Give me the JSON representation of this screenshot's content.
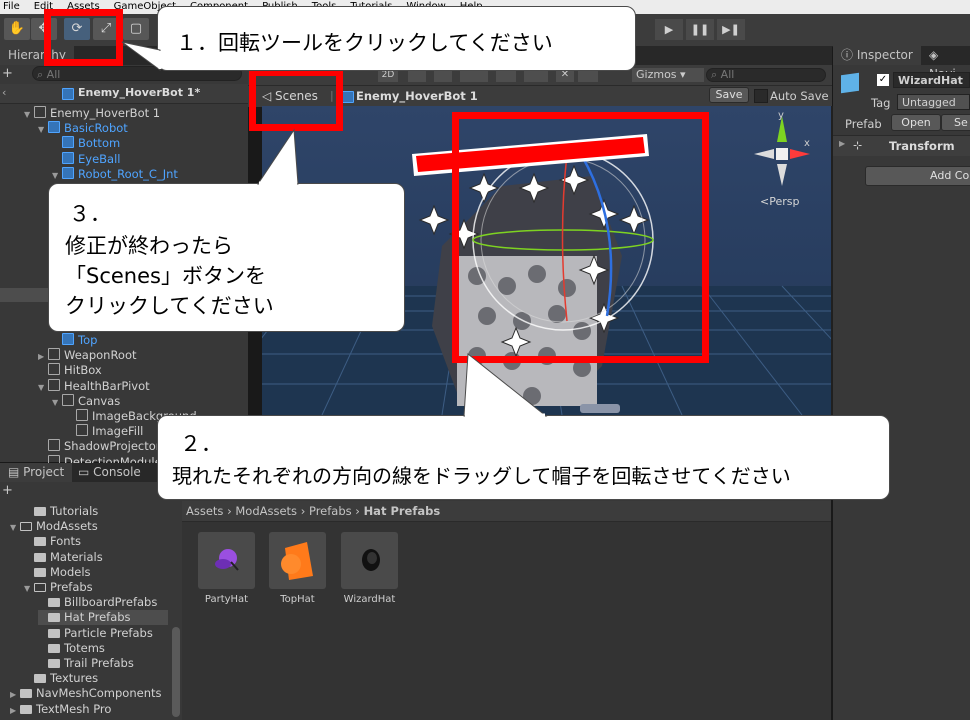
{
  "menu": [
    "File",
    "Edit",
    "Assets",
    "GameObject",
    "Component",
    "Publish",
    "Tools",
    "Tutorials",
    "Window",
    "Help"
  ],
  "toolbar": {
    "hand_icon": "hand-icon",
    "move_icon": "move-icon",
    "rotate_icon": "rotate-icon",
    "scale_icon": "scale-icon",
    "rect_icon": "rect-icon",
    "play": "▶",
    "pause": "❚❚",
    "step": "▶❚"
  },
  "hierarchy": {
    "tab_label": "Hierarchy",
    "search_placeholder": "All",
    "add": "+",
    "scene_title": "Enemy_HoverBot 1*",
    "rows": [
      {
        "label": "Enemy_HoverBot 1",
        "indent": 0,
        "tri": "▼",
        "blue": false
      },
      {
        "label": "BasicRobot",
        "indent": 1,
        "tri": "▼",
        "blue": true
      },
      {
        "label": "Bottom",
        "indent": 2,
        "tri": "",
        "blue": true
      },
      {
        "label": "EyeBall",
        "indent": 2,
        "tri": "",
        "blue": true
      },
      {
        "label": "Robot_Root_C_Jnt",
        "indent": 2,
        "tri": "▼",
        "blue": true
      }
    ],
    "rows_lower": [
      {
        "label": "Top",
        "indent": 2,
        "tri": "",
        "blue": true
      },
      {
        "label": "WeaponRoot",
        "indent": 1,
        "tri": "▶",
        "blue": false
      },
      {
        "label": "HitBox",
        "indent": 1,
        "tri": "",
        "blue": false
      },
      {
        "label": "HealthBarPivot",
        "indent": 1,
        "tri": "▼",
        "blue": false
      },
      {
        "label": "Canvas",
        "indent": 2,
        "tri": "▼",
        "blue": false
      },
      {
        "label": "ImageBackground",
        "indent": 3,
        "tri": "",
        "blue": false
      },
      {
        "label": "ImageFill",
        "indent": 3,
        "tri": "",
        "blue": false
      },
      {
        "label": "ShadowProjector",
        "indent": 1,
        "tri": "",
        "blue": false
      },
      {
        "label": "DetectionModule",
        "indent": 1,
        "tri": "",
        "blue": false
      }
    ]
  },
  "scene": {
    "breadcrumb_scenes": "Scenes",
    "breadcrumb_prefab": "Enemy_HoverBot 1",
    "save": "Save",
    "auto_save": "Auto Save",
    "mode_2d": "2D",
    "gizmos": "Gizmos",
    "search_placeholder": "All",
    "persp": "<Persp",
    "gizmo_y": "y",
    "gizmo_x": "x"
  },
  "project": {
    "tab_project": "Project",
    "tab_console": "Console",
    "add": "+",
    "breadcrumb": [
      "Assets",
      "ModAssets",
      "Prefabs",
      "Hat Prefabs"
    ],
    "tree": [
      {
        "label": "Tutorials",
        "indent": 1,
        "open": false,
        "tri": ""
      },
      {
        "label": "ModAssets",
        "indent": 0,
        "open": true,
        "tri": "▼"
      },
      {
        "label": "Fonts",
        "indent": 1,
        "open": false,
        "tri": ""
      },
      {
        "label": "Materials",
        "indent": 1,
        "open": false,
        "tri": ""
      },
      {
        "label": "Models",
        "indent": 1,
        "open": false,
        "tri": ""
      },
      {
        "label": "Prefabs",
        "indent": 1,
        "open": true,
        "tri": "▼"
      },
      {
        "label": "BillboardPrefabs",
        "indent": 2,
        "open": false,
        "tri": ""
      },
      {
        "label": "Hat Prefabs",
        "indent": 2,
        "open": false,
        "tri": "",
        "selected": true
      },
      {
        "label": "Particle Prefabs",
        "indent": 2,
        "open": false,
        "tri": ""
      },
      {
        "label": "Totems",
        "indent": 2,
        "open": false,
        "tri": ""
      },
      {
        "label": "Trail Prefabs",
        "indent": 2,
        "open": false,
        "tri": ""
      },
      {
        "label": "Textures",
        "indent": 1,
        "open": false,
        "tri": ""
      },
      {
        "label": "NavMeshComponents",
        "indent": 0,
        "open": false,
        "tri": "▶"
      },
      {
        "label": "TextMesh Pro",
        "indent": 0,
        "open": false,
        "tri": "▶"
      }
    ],
    "assets": [
      {
        "label": "PartyHat",
        "icon": "party-hat-icon"
      },
      {
        "label": "TopHat",
        "icon": "top-hat-icon"
      },
      {
        "label": "WizardHat",
        "icon": "wizard-hat-icon"
      }
    ]
  },
  "inspector": {
    "tab_inspector": "Inspector",
    "tab_navigation": "Navi",
    "object_name": "WizardHat",
    "tag_label": "Tag",
    "tag_value": "Untagged",
    "prefab_label": "Prefab",
    "open": "Open",
    "select": "Se",
    "transform": "Transform",
    "add_component": "Add Co"
  },
  "callouts": {
    "c1": "１．回転ツールをクリックしてください",
    "c3_num": "３．",
    "c3_line1": "修正が終わったら",
    "c3_line2": "「Scenes」ボタンを",
    "c3_line3": "クリックしてください",
    "c2_num": "２．",
    "c2_line1": "現れたそれぞれの方向の線をドラッグして帽子を回転させてください"
  },
  "colors": {
    "highlight": "#ff0000",
    "scene_sky": "#2c3e5c",
    "scene_floor": "#1e3550",
    "selection": "#46607c"
  }
}
